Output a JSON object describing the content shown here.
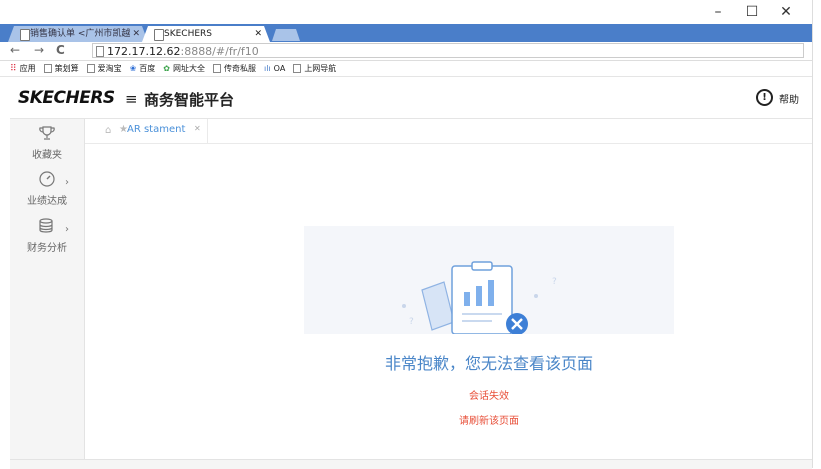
{
  "browser": {
    "tabs": [
      {
        "label": "销售确认单 <广州市凯越",
        "active": false
      },
      {
        "label": "SKECHERS",
        "active": true
      }
    ],
    "url_host": "172.17.12.62",
    "url_rest": ":8888/#/fr/f10",
    "bookmarks": [
      "应用",
      "策划算",
      "爱淘宝",
      "百度",
      "网址大全",
      "传奇私服",
      "OA",
      "上网导航"
    ]
  },
  "app": {
    "logo": "SKECHERS",
    "title": "商务智能平台",
    "help_label": "帮助"
  },
  "sidebar": {
    "items": [
      {
        "label": "收藏夹",
        "icon": "trophy-icon"
      },
      {
        "label": "业绩达成",
        "icon": "gauge-icon"
      },
      {
        "label": "财务分析",
        "icon": "coins-icon"
      }
    ]
  },
  "content": {
    "tab_label": "AR stament",
    "error_title": "非常抱歉，您无法查看该页面",
    "error_line1": "会话失效",
    "error_line2": "请刷新该页面"
  },
  "colors": {
    "tabstrip": "#4a7ec9",
    "accent": "#4a86c8",
    "error": "#e8503a"
  }
}
